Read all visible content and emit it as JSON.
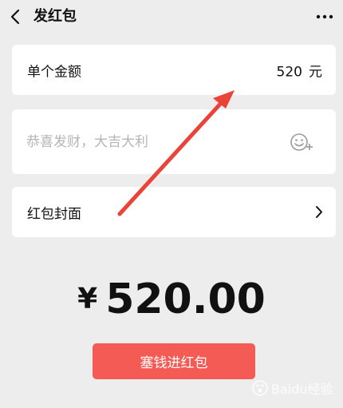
{
  "header": {
    "title": "发红包",
    "back_icon": "back-arrow-icon",
    "more_icon": "more-dots-icon"
  },
  "amount": {
    "label": "单个金额",
    "value": "520",
    "unit": "元"
  },
  "greeting": {
    "placeholder": "恭喜发财，大吉大利",
    "value": "",
    "emoji_icon": "emoji-icon"
  },
  "cover": {
    "label": "红包封面",
    "icon": "chevron-right-icon"
  },
  "total": {
    "currency": "¥",
    "value": "520.00"
  },
  "send_button": {
    "label": "塞钱进红包",
    "color": "#f55b55"
  },
  "annotation": {
    "arrow_color": "#e9433a"
  },
  "watermark": {
    "text": "Baidu经验"
  },
  "colors": {
    "background": "#ededed",
    "card": "#ffffff",
    "placeholder": "#b5b5b5"
  }
}
